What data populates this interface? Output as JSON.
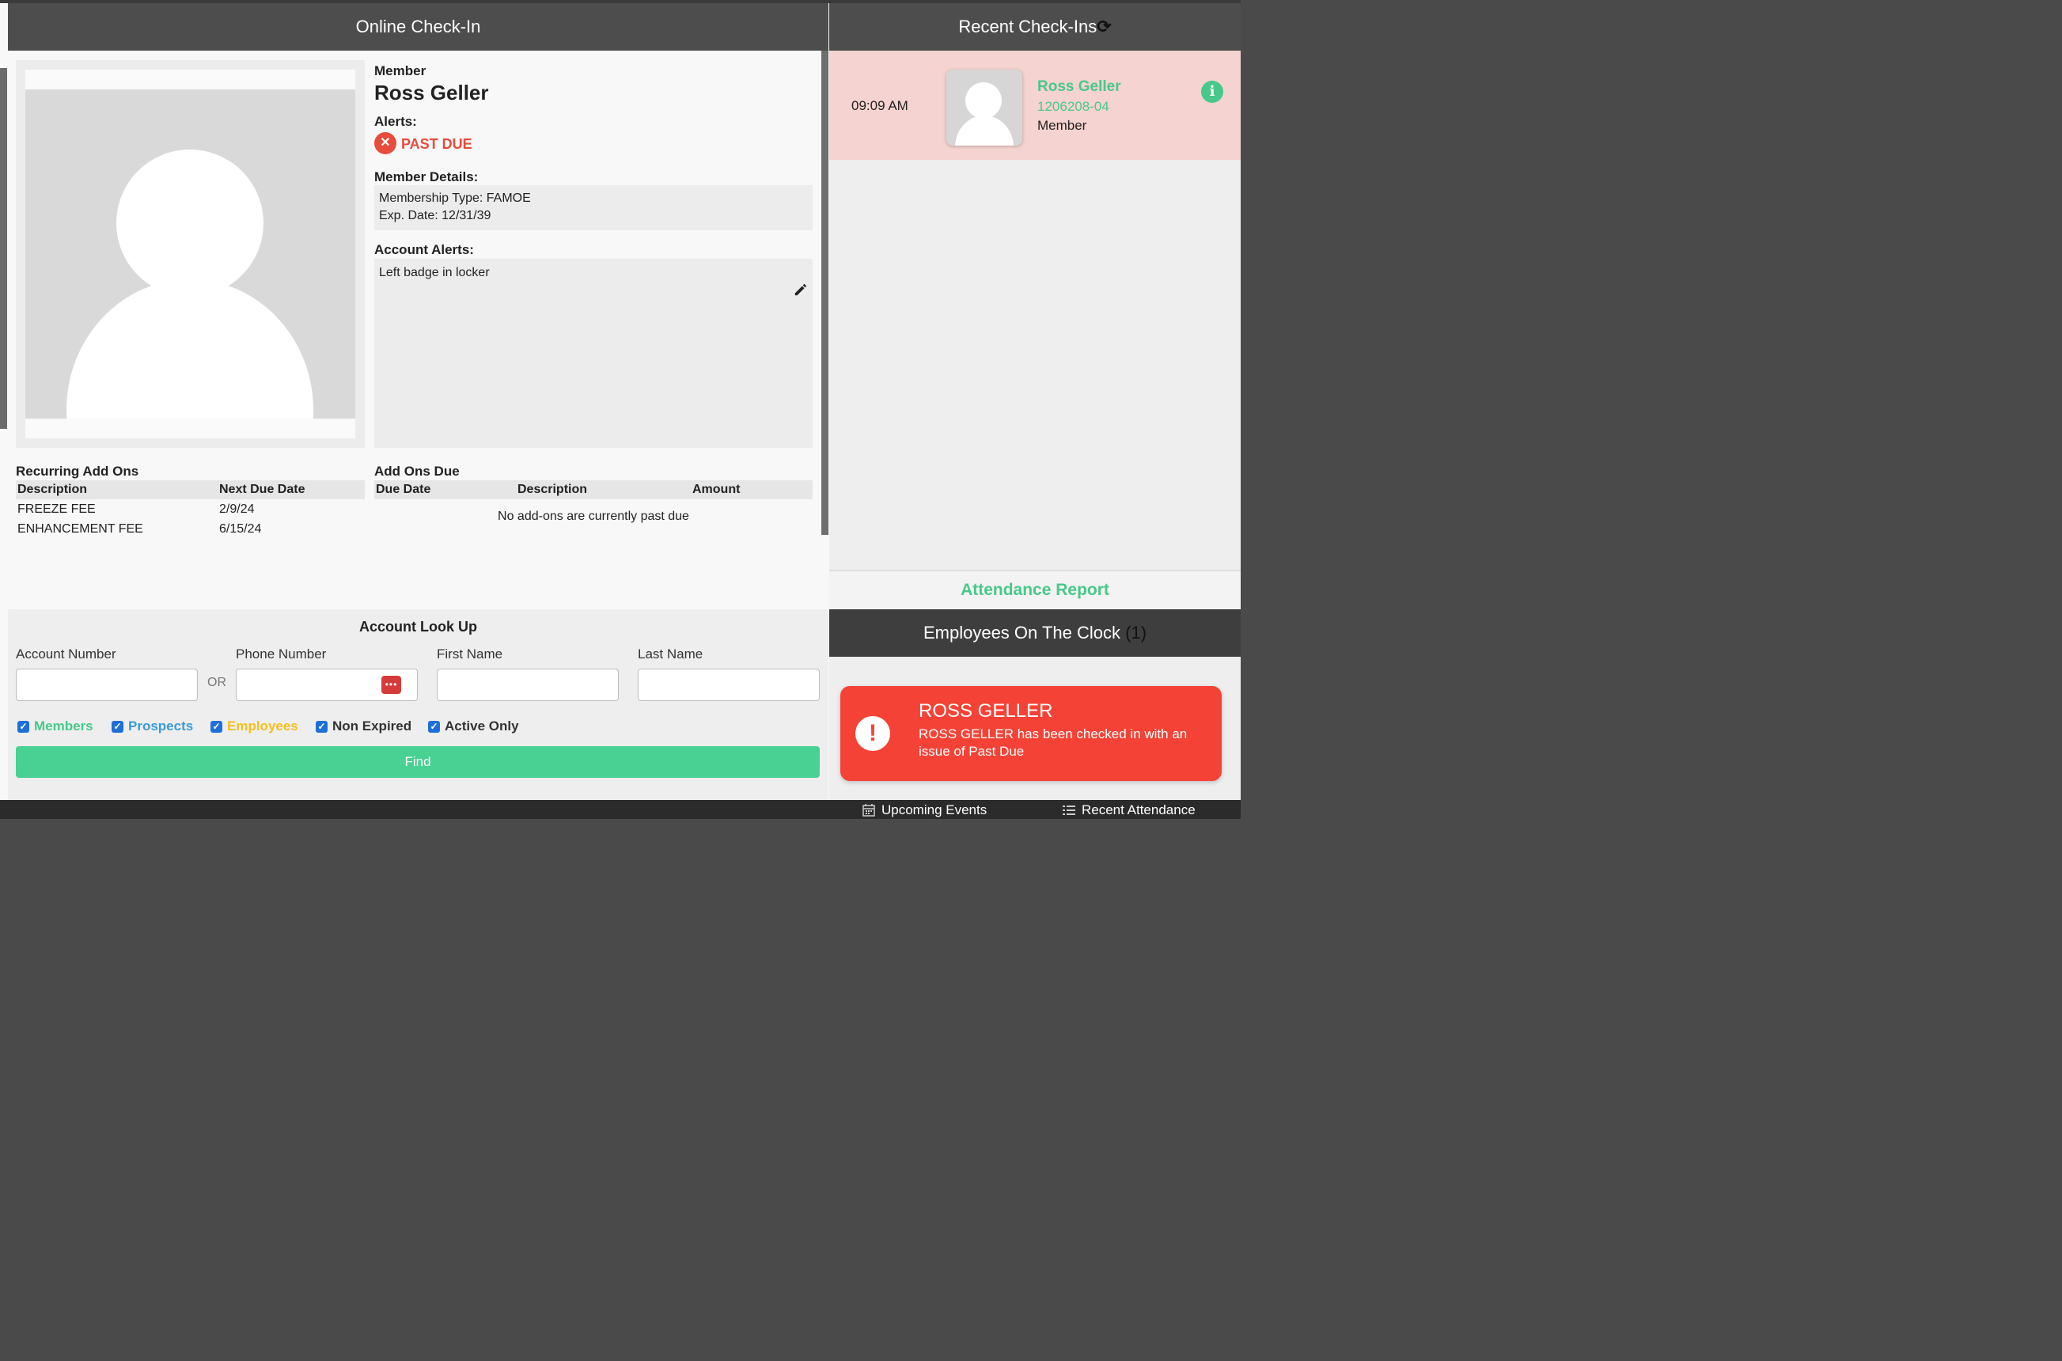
{
  "left_panel": {
    "title": "Online Check-In",
    "member_label": "Member",
    "member_name": "Ross Geller",
    "alerts_label": "Alerts:",
    "alert_text": "PAST DUE",
    "member_details_label": "Member Details:",
    "membership_type": "Membership Type: FAMOE",
    "exp_date": "Exp. Date: 12/31/39",
    "account_alerts_label": "Account Alerts:",
    "account_alerts_text": "Left badge in locker",
    "recurring": {
      "title": "Recurring Add Ons",
      "headers": [
        "Description",
        "Next Due Date"
      ],
      "rows": [
        {
          "description": "FREEZE FEE",
          "date": "2/9/24"
        },
        {
          "description": "ENHANCEMENT FEE",
          "date": "6/15/24"
        }
      ]
    },
    "addons_due": {
      "title": "Add Ons Due",
      "headers": [
        "Due Date",
        "Description",
        "Amount"
      ],
      "empty_text": "No add-ons are currently past due"
    }
  },
  "lookup": {
    "title": "Account Look Up",
    "account_number_label": "Account Number",
    "or_label": "OR",
    "phone_number_label": "Phone Number",
    "first_name_label": "First Name",
    "last_name_label": "Last Name",
    "account_number_value": "",
    "phone_number_value": "",
    "first_name_value": "",
    "last_name_value": "",
    "checkboxes": [
      {
        "label": "Members",
        "checked": true,
        "color": "#48c88a"
      },
      {
        "label": "Prospects",
        "checked": true,
        "color": "#3a9ad9"
      },
      {
        "label": "Employees",
        "checked": true,
        "color": "#f0c020"
      },
      {
        "label": "Non Expired",
        "checked": true,
        "color": "#333333"
      },
      {
        "label": "Active Only",
        "checked": true,
        "color": "#333333"
      }
    ],
    "find_label": "Find"
  },
  "right_panel": {
    "title": "Recent Check-Ins",
    "refresh_icon": "refresh-icon",
    "checkin": {
      "time": "09:09 AM",
      "name": "Ross Geller",
      "id": "1206208-04",
      "type": "Member"
    },
    "attendance_report": "Attendance Report",
    "employees_on_clock_label": "Employees On The Clock",
    "employees_on_clock_count": "(1)",
    "toast": {
      "title": "ROSS GELLER",
      "message": "ROSS GELLER has been checked in with an issue of Past Due"
    }
  },
  "bottom_bar": {
    "upcoming_events": "Upcoming Events",
    "recent_attendance": "Recent Attendance"
  },
  "colors": {
    "accent_green": "#48c88a",
    "alert_red": "#e74c3c",
    "header_dark": "#4d4d4d"
  }
}
